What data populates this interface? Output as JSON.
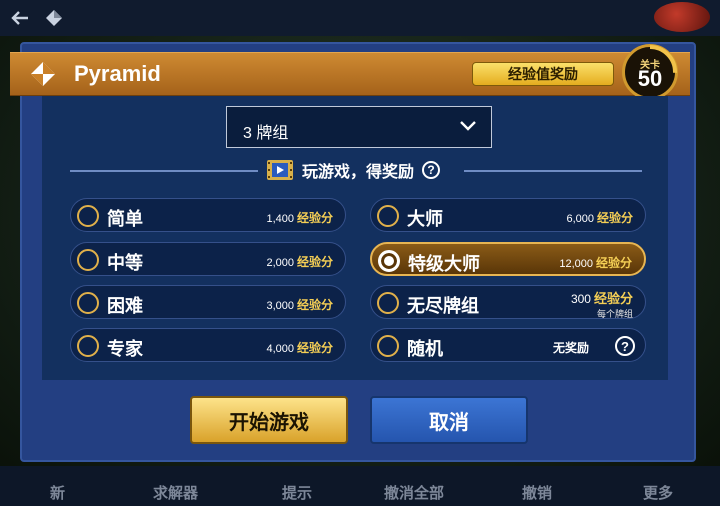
{
  "toolbar": {
    "back_icon": "arrow-left-icon",
    "suit_icon": "diamond-icon"
  },
  "dialog": {
    "title": "Pyramid",
    "xp_button": "经验值奖励",
    "level_label": "关卡",
    "level_value": "50",
    "deck_select": {
      "value": "3 牌组"
    },
    "reward_heading": "玩游戏，得奖励",
    "options": [
      {
        "label": "简单",
        "points": "1,400",
        "unit": "经验分",
        "selected": false
      },
      {
        "label": "中等",
        "points": "2,000",
        "unit": "经验分",
        "selected": false
      },
      {
        "label": "困难",
        "points": "3,000",
        "unit": "经验分",
        "selected": false
      },
      {
        "label": "专家",
        "points": "4,000",
        "unit": "经验分",
        "selected": false
      },
      {
        "label": "大师",
        "points": "6,000",
        "unit": "经验分",
        "selected": false
      },
      {
        "label": "特级大师",
        "points": "12,000",
        "unit": "经验分",
        "selected": true
      },
      {
        "label": "无尽牌组",
        "points": "300",
        "unit": "经验分",
        "sub": "每个牌组",
        "selected": false
      },
      {
        "label": "随机",
        "no_reward": "无奖励",
        "selected": false
      }
    ],
    "start_button": "开始游戏",
    "cancel_button": "取消"
  },
  "bottom_bar": {
    "items": [
      "新",
      "求解器",
      "提示",
      "撤消全部",
      "撤销",
      "更多"
    ]
  },
  "colors": {
    "dialog_bg": "#233f82",
    "title_bar": "#ce8a32",
    "accent_gold": "#f5cf55",
    "cancel_blue": "#2f64c2"
  }
}
